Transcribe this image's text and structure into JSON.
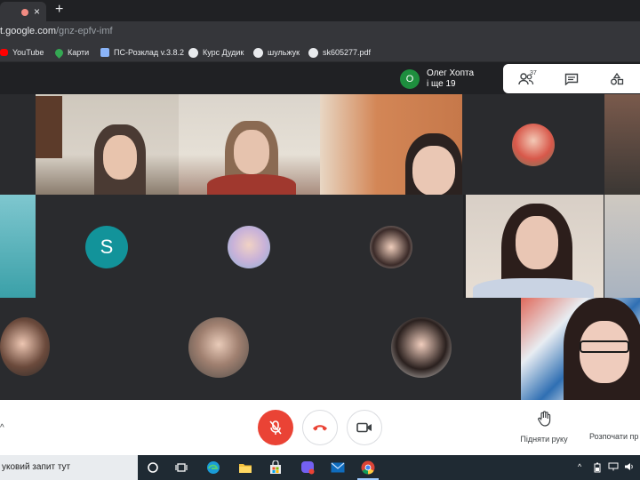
{
  "browser": {
    "tab_close": "×",
    "new_tab": "+",
    "url_host": "t.google.com",
    "url_path": "/gnz-epfv-imf"
  },
  "bookmarks": [
    {
      "label": "YouTube",
      "icon": "youtube-icon",
      "color": "#ff0000"
    },
    {
      "label": "Карти",
      "icon": "maps-pin-icon",
      "color": "#34a853"
    },
    {
      "label": "ПС-Розклад v.3.8.2",
      "icon": "schedule-icon",
      "color": "#8ab4f8"
    },
    {
      "label": "Курс Дудик",
      "icon": "globe-icon",
      "color": "#e8eaed"
    },
    {
      "label": "шульжук",
      "icon": "globe-icon",
      "color": "#e8eaed"
    },
    {
      "label": "sk605277.pdf",
      "icon": "globe-icon",
      "color": "#e8eaed"
    }
  ],
  "meet": {
    "presenter_initial": "О",
    "presenter_name": "Олег Хопта",
    "presenter_more": "і ще 19",
    "participants_count": "37",
    "participant_initial": "S",
    "raise_hand_label": "Підняти руку",
    "present_label": "Розпочати пр"
  },
  "taskbar": {
    "search_text": "уковий запит тут"
  },
  "colors": {
    "end_call": "#ea4335",
    "mic_off": "#d93025",
    "avatar_teal": "#12939a",
    "presenter_green": "#1e8e3e"
  }
}
